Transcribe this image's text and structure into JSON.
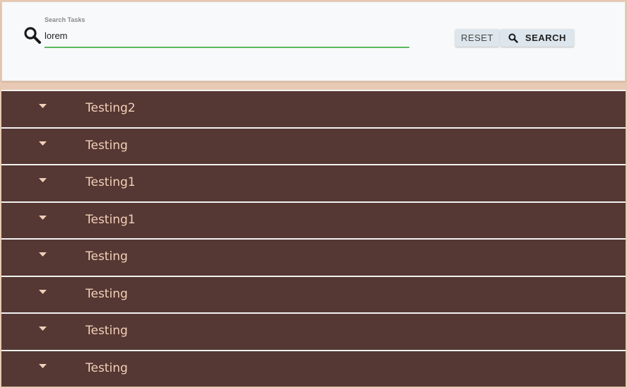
{
  "search": {
    "label": "Search Tasks",
    "value": "lorem",
    "icon": "search-icon",
    "accent_color": "#5cb85c"
  },
  "buttons": {
    "reset_label": "RESET",
    "search_label": "SEARCH"
  },
  "tasks": [
    {
      "title": "Testing2"
    },
    {
      "title": "Testing"
    },
    {
      "title": "Testing1"
    },
    {
      "title": "Testing1"
    },
    {
      "title": "Testing"
    },
    {
      "title": "Testing"
    },
    {
      "title": "Testing"
    },
    {
      "title": "Testing"
    }
  ],
  "colors": {
    "row_background": "#553733",
    "row_text": "#f1d0b8",
    "page_background": "#e8c9b3"
  }
}
